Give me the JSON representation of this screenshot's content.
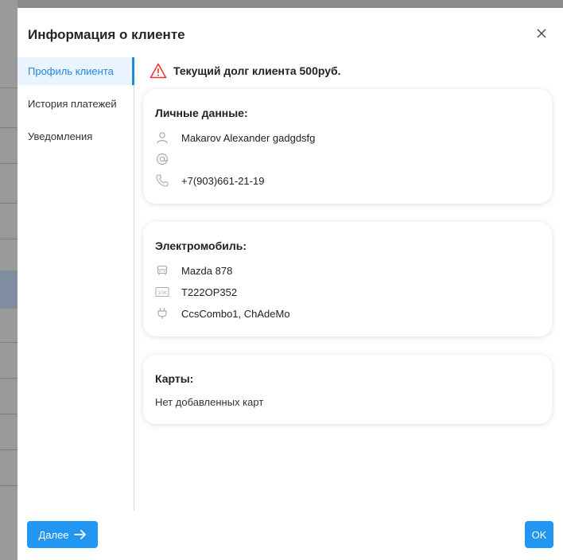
{
  "modal": {
    "title": "Информация о клиенте"
  },
  "sidebar": {
    "items": [
      {
        "label": "Профиль клиента",
        "active": true
      },
      {
        "label": "История платежей",
        "active": false
      },
      {
        "label": "Уведомления",
        "active": false
      }
    ]
  },
  "debt": {
    "text": "Текущий долг клиента 500руб.",
    "icon": "warning-icon"
  },
  "personal": {
    "title": "Личные данные:",
    "name": "Makarov Alexander gadgdsfg",
    "email": "",
    "phone": "+7(903)661-21-19"
  },
  "vehicle": {
    "title": "Электромобиль:",
    "model": "Mazda 878",
    "plate": "T222OP352",
    "connectors": "CcsCombo1, ChAdeMo"
  },
  "cards": {
    "title": "Карты:",
    "empty_text": "Нет добавленных карт"
  },
  "footer": {
    "next_label": "Далее",
    "ok_label": "OK"
  },
  "colors": {
    "accent": "#2196f3",
    "warning": "#e53935"
  }
}
